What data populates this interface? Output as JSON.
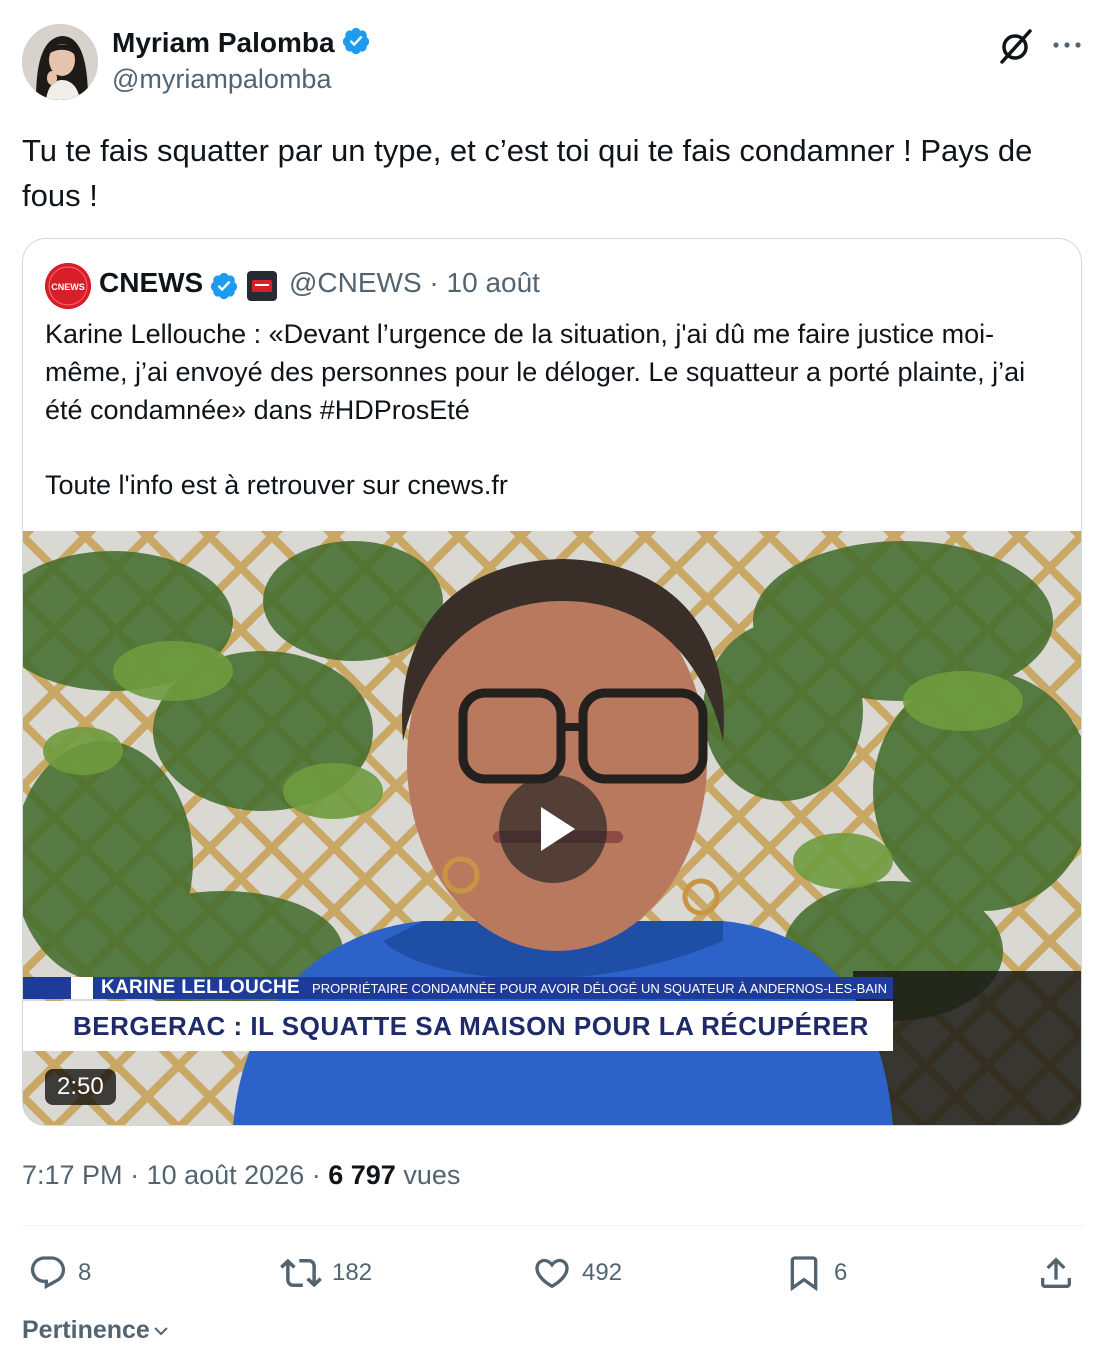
{
  "author": {
    "name": "Myriam Palomba",
    "handle": "@myriampalomba",
    "verified": true
  },
  "tweet": {
    "text": "Tu te fais squatter par un type, et c’est toi qui te fais condamner ! Pays de fous !"
  },
  "quote": {
    "name": "CNEWS",
    "meta": "@CNEWS · 10 août",
    "paragraph1": "Karine Lellouche : «Devant l’urgence de la situation, j'ai dû me faire justice moi-même, j’ai envoyé des personnes pour le déloger. Le squatteur a porté plainte, j’ai été condamnée» dans #HDProsEté",
    "paragraph2": "Toute l'info est à retrouver sur cnews.fr",
    "video": {
      "ribbon_name": "KARINE LELLOUCHE",
      "ribbon_role": "PROPRIÉTAIRE CONDAMNÉE POUR AVOIR DÉLOGÉ UN SQUATEUR À ANDERNOS-LES-BAIN",
      "headline": "BERGERAC : IL SQUATTE SA MAISON POUR LA RÉCUPÉRER",
      "duration": "2:50"
    }
  },
  "stats": {
    "time": "7:17 PM",
    "date": "10 août 2026",
    "views": "6 797",
    "views_label": "vues"
  },
  "actions": {
    "replies": "8",
    "retweets": "182",
    "likes": "492",
    "bookmarks": "6"
  },
  "sort_label": "Pertinence",
  "colors": {
    "text": "#0f1419",
    "secondary": "#536471",
    "verified": "#1d9bf0",
    "border": "#cfd9de",
    "cnews_red": "#d81e28"
  }
}
